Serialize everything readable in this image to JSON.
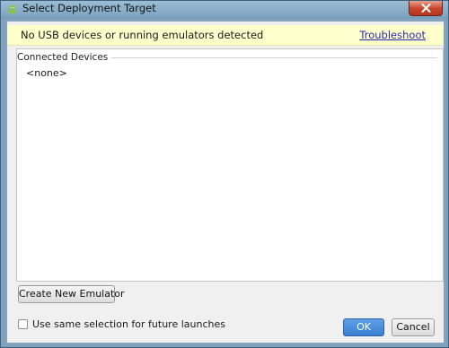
{
  "window": {
    "title": "Select Deployment Target",
    "icon": "android-icon"
  },
  "warning": {
    "message": "No USB devices or running emulators detected",
    "link_label": "Troubleshoot",
    "background": "#ffffcc"
  },
  "devices": {
    "heading": "Connected Devices",
    "items": [
      "<none>"
    ]
  },
  "actions": {
    "create_emulator_label": "Create New Emulator",
    "remember_selection_label": "Use same selection for future launches",
    "remember_selection_checked": false,
    "ok_label": "OK",
    "cancel_label": "Cancel"
  },
  "colors": {
    "ok_button": "#3a7fd4",
    "close_button": "#c8432a",
    "link": "#2a2ab0"
  }
}
